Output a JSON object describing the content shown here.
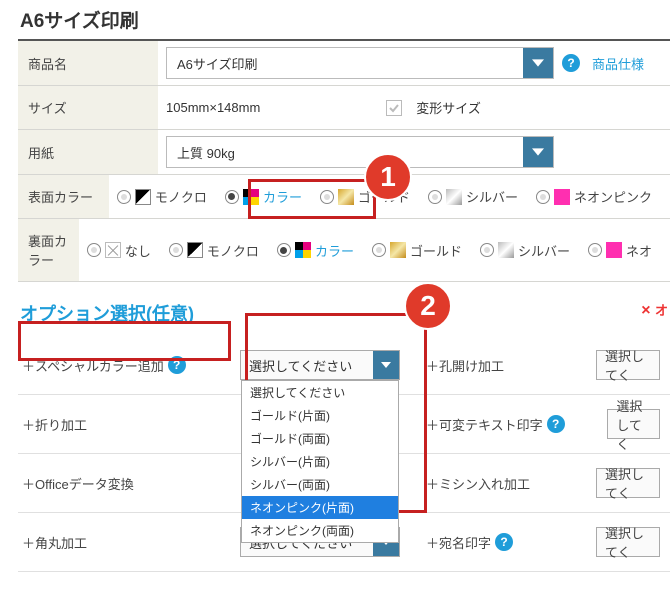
{
  "header": {
    "title": "A6サイズ印刷"
  },
  "rows": {
    "productName": {
      "label": "商品名",
      "value": "A6サイズ印刷",
      "specLink": "商品仕様"
    },
    "size": {
      "label": "サイズ",
      "value": "105mm×148mm",
      "shapeCheckbox": "変形サイズ"
    },
    "paper": {
      "label": "用紙",
      "value": "上質 90kg"
    },
    "front": {
      "label": "表面カラー",
      "options": {
        "bw": "モノクロ",
        "color": "カラー",
        "gold": "ゴールド",
        "silver": "シルバー",
        "neon": "ネオンピンク"
      }
    },
    "back": {
      "label": "裏面カラー",
      "options": {
        "none": "なし",
        "bw": "モノクロ",
        "color": "カラー",
        "gold": "ゴールド",
        "silver": "シルバー",
        "neon": "ネオ"
      }
    }
  },
  "options": {
    "title": "オプション選択(任意)",
    "closeLabel": "オ",
    "rows": [
      {
        "label": "＋スペシャルカラー追加",
        "help": true,
        "dropdown": {
          "value": "選択してください",
          "open": true,
          "items": [
            {
              "text": "選択してください"
            },
            {
              "text": "ゴールド(片面)"
            },
            {
              "text": "ゴールド(両面)"
            },
            {
              "text": "シルバー(片面)"
            },
            {
              "text": "シルバー(両面)"
            },
            {
              "text": "ネオンピンク(片面)",
              "selected": true
            },
            {
              "text": "ネオンピンク(両面)"
            }
          ]
        },
        "right": {
          "label": "＋孔開け加工",
          "value": "選択してく"
        }
      },
      {
        "label": "＋折り加工",
        "right": {
          "label": "＋可変テキスト印字",
          "help": true,
          "value": "選択してく"
        }
      },
      {
        "label": "＋Officeデータ変換",
        "right": {
          "label": "＋ミシン入れ加工",
          "value": "選択してく"
        }
      },
      {
        "label": "＋角丸加工",
        "value": "選択してください",
        "right": {
          "label": "＋宛名印字",
          "help": true,
          "value": "選択してく"
        }
      }
    ]
  },
  "badges": {
    "b1": "1",
    "b2": "2"
  }
}
